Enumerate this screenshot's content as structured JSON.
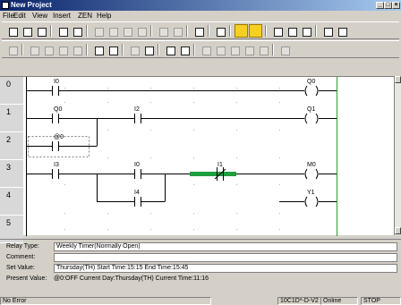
{
  "window": {
    "title": "New Project"
  },
  "menu": [
    "File",
    "Edit",
    "View",
    "Insert",
    "ZEN",
    "Help"
  ],
  "ladder": {
    "row_numbers": [
      "0",
      "1",
      "2",
      "3",
      "4",
      "5"
    ],
    "elements": [
      {
        "kind": "no",
        "label": "I0"
      },
      {
        "kind": "coil",
        "label": "Q0"
      },
      {
        "kind": "no",
        "label": "Q0"
      },
      {
        "kind": "no",
        "label": "I2"
      },
      {
        "kind": "coil",
        "label": "Q1"
      },
      {
        "kind": "no",
        "label": "@0"
      },
      {
        "kind": "no",
        "label": "I3"
      },
      {
        "kind": "no",
        "label": "I0"
      },
      {
        "kind": "nc",
        "label": "I1"
      },
      {
        "kind": "coil",
        "label": "M0"
      },
      {
        "kind": "no",
        "label": "I4"
      },
      {
        "kind": "coil",
        "label": "Y1"
      }
    ]
  },
  "properties": {
    "relay_type_label": "Relay Type:",
    "relay_type_value": "Weekly Timer(Normally Open)",
    "comment_label": "Comment:",
    "comment_value": "",
    "set_value_label": "Set Value:",
    "set_value_value": "Thursday(TH)   Start Time:15:15  End Time:15:45",
    "present_value_label": "Present Value:",
    "present_value_value": "@0:OFF  Current Day:Thursday(TH)  Current Time:11:16"
  },
  "status": {
    "error": "No Error",
    "device": "10C1D*-D-V2",
    "connection": "Online",
    "mode": "STOP"
  }
}
